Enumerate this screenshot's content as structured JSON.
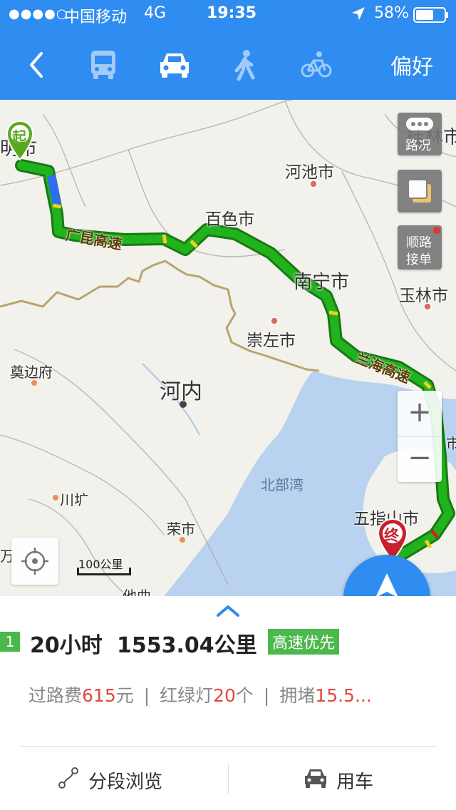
{
  "status_bar": {
    "signal": "●●●●○",
    "carrier": "中国移动",
    "network": "4G",
    "time": "19:35",
    "battery": "58%"
  },
  "nav": {
    "modes": [
      "back-icon",
      "bus-icon",
      "car-icon",
      "walk-icon",
      "bike-icon"
    ],
    "active_mode": "car",
    "preference": "偏好"
  },
  "map": {
    "start_marker": "起",
    "end_marker": "终",
    "traffic_label": "路况",
    "order_label_1": "顺路",
    "order_label_2": "接单",
    "zoom_in": "+",
    "zoom_out": "−",
    "scale": "100公里",
    "navigate": "导航",
    "places": {
      "kunming": "明市",
      "guilin": "桂林市",
      "hechi": "河池市",
      "baise": "百色市",
      "nanning": "南宁市",
      "yulin": "玉林市",
      "chongzuo": "崇左市",
      "dienbien": "奠边府",
      "hanoi": "河内",
      "beibuwan": "北部湾",
      "wuzhishan": "五指山市",
      "chuanguang": "川圹",
      "rongshi": "荣市",
      "tabei": "他曲",
      "partial_left": "万",
      "partial_right": "市"
    },
    "roads": {
      "guangkun": "广昆高速",
      "lanhai": "兰海高速"
    },
    "colors": {
      "route": "#22b21e",
      "route_slow": "#2f6ef0",
      "accent": "#2f8cf0",
      "marker_end": "#c8202c",
      "marker_start": "#5aa820"
    }
  },
  "summary": {
    "route_index": "1",
    "duration": "20小时",
    "distance": "1553.04公里",
    "tag": "高速优先",
    "toll_label": "过路费",
    "toll_value": "615",
    "toll_unit": "元",
    "sep1": "|",
    "lights_label": "红绿灯",
    "lights_value": "20",
    "lights_unit": "个",
    "sep2": "|",
    "jam_label": "拥堵",
    "jam_value": "15.5..."
  },
  "actions": {
    "segments": "分段浏览",
    "car": "用车"
  }
}
